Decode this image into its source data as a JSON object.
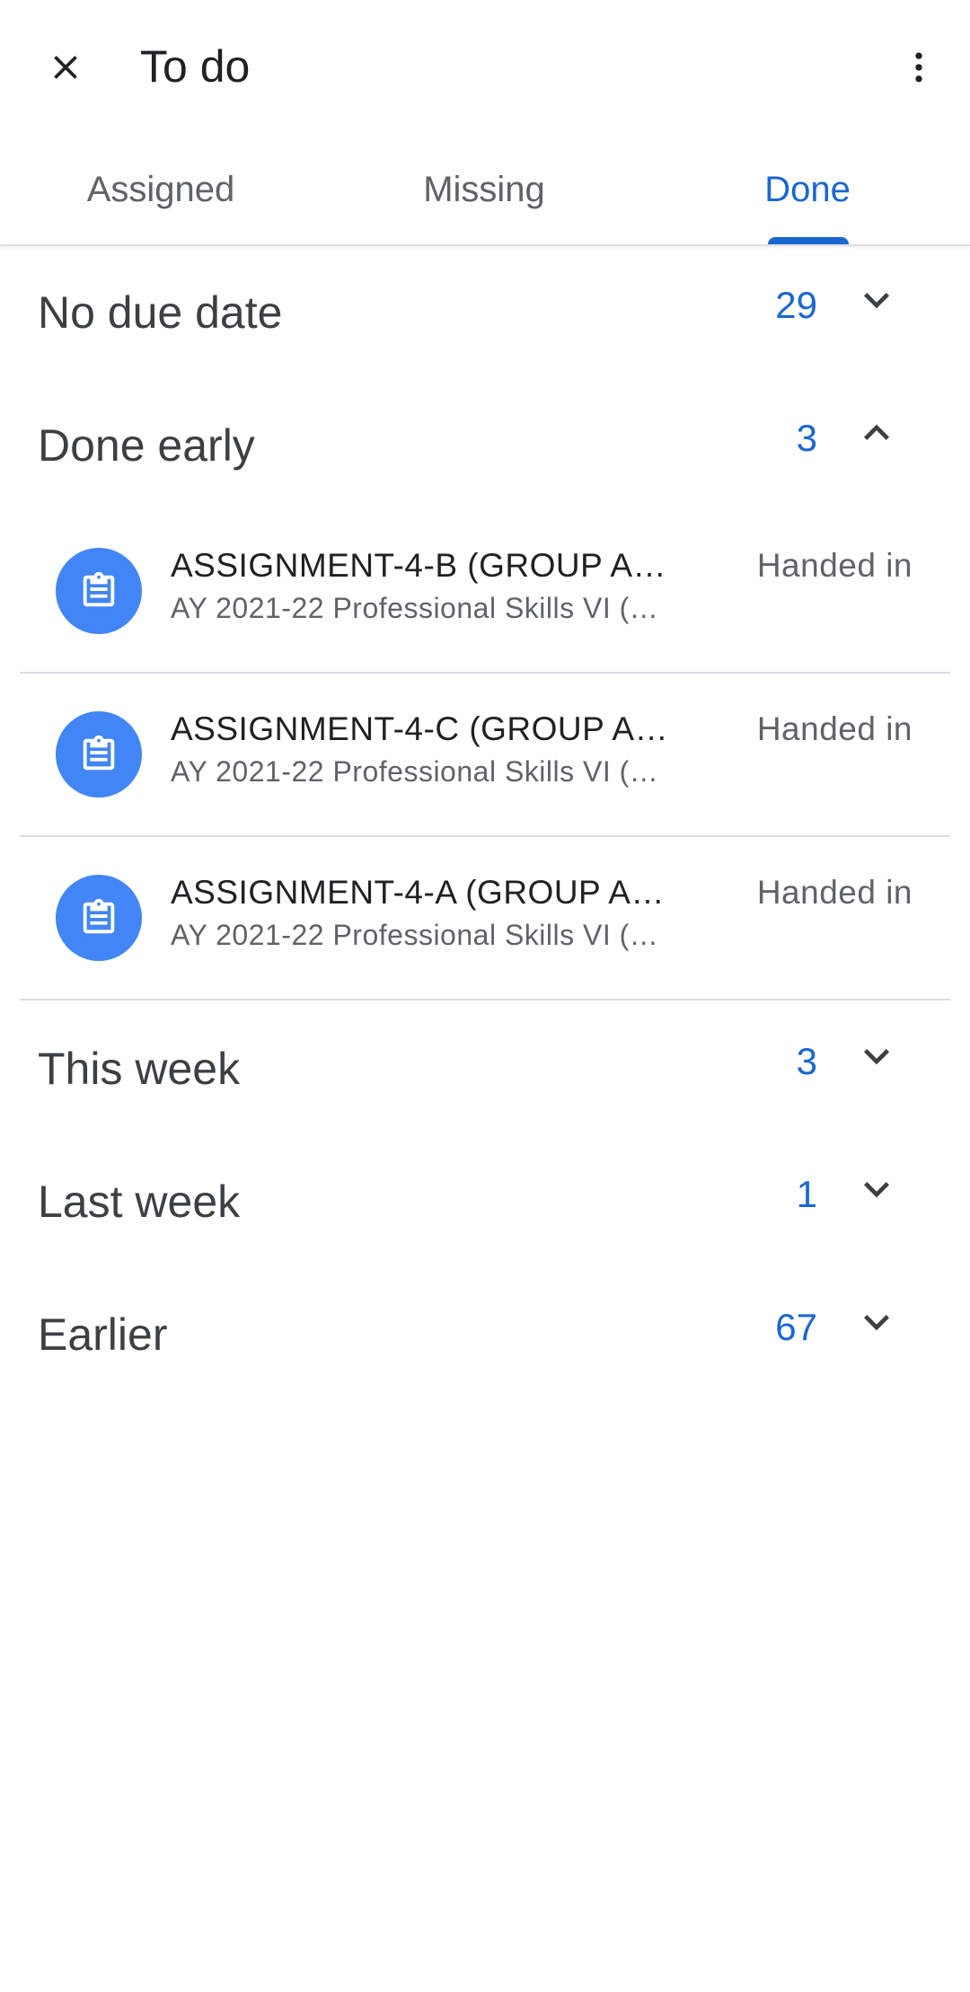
{
  "appbar": {
    "title": "To do",
    "close_icon": "close-icon",
    "more_icon": "more-vert-icon"
  },
  "tabs": [
    {
      "label": "Assigned",
      "active": false
    },
    {
      "label": "Missing",
      "active": false
    },
    {
      "label": "Done",
      "active": true
    }
  ],
  "colors": {
    "accent": "#1967d2",
    "icon_bg": "#4285f4",
    "divider": "#dadce0"
  },
  "sections": [
    {
      "title": "No due date",
      "count": "29",
      "expanded": false
    },
    {
      "title": "Done early",
      "count": "3",
      "expanded": true
    },
    {
      "title": "This week",
      "count": "3",
      "expanded": false
    },
    {
      "title": "Last week",
      "count": "1",
      "expanded": false
    },
    {
      "title": "Earlier",
      "count": "67",
      "expanded": false
    }
  ],
  "done_early_items": [
    {
      "title": "ASSIGNMENT-4-B (GROUP A…",
      "subtitle": "AY 2021-22 Professional Skills VI (…",
      "status": "Handed in",
      "icon": "assignment-icon"
    },
    {
      "title": "ASSIGNMENT-4-C (GROUP A…",
      "subtitle": "AY 2021-22 Professional Skills VI (…",
      "status": "Handed in",
      "icon": "assignment-icon"
    },
    {
      "title": "ASSIGNMENT-4-A (GROUP A…",
      "subtitle": "AY 2021-22 Professional Skills VI (…",
      "status": "Handed in",
      "icon": "assignment-icon"
    }
  ]
}
